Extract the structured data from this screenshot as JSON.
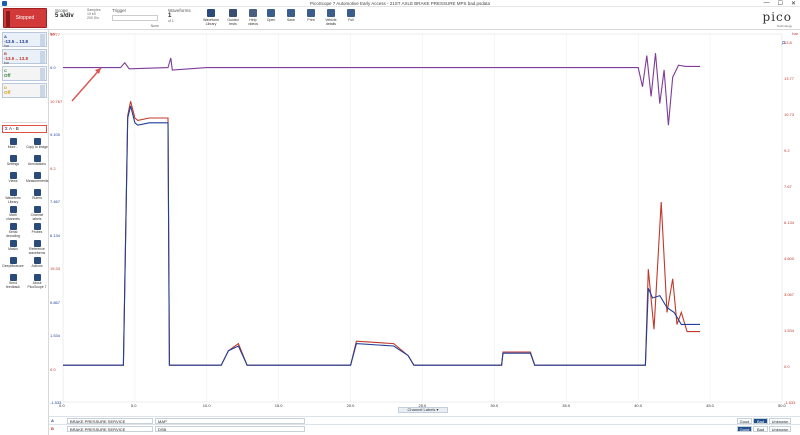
{
  "window": {
    "title": "PicoScope 7 Automotive Early Access - 21ST AXLE BRAKE PRESSURE MPS bad.psdata",
    "controls": [
      "—",
      "☐",
      "✕"
    ]
  },
  "ribbon": {
    "run_button": "Stopped",
    "scope_label": "Scope",
    "timebase": "5 s/div",
    "samples_label": "Samples",
    "samples_value": "10 kS",
    "sample_rate": "200 S/s",
    "trigger_label": "Trigger",
    "trigger_value": "None",
    "waveforms_label": "Waveforms",
    "waveforms_value": "1",
    "waveforms_of": "of 1",
    "tools": [
      "Waveform Library",
      "Guided tests",
      "Help videos",
      "Open",
      "Save",
      "Print",
      "Vehicle details",
      "Full"
    ],
    "brand": "pico",
    "brand_sub": "Technology"
  },
  "sidebar": {
    "channels": [
      {
        "tag": "A",
        "range": "-13.5 .. 13.8",
        "unit": "bar",
        "coupling": "DC 1x1"
      },
      {
        "tag": "B",
        "range": "-13.5 .. 13.8",
        "unit": "bar",
        "coupling": "DC 1x1"
      },
      {
        "tag": "C",
        "range": "Off",
        "coupling": "DC"
      },
      {
        "tag": "D",
        "range": "Off",
        "coupling": "DC"
      }
    ],
    "math": "A - B",
    "tools": [
      {
        "name": "More...",
        "icon": "grid-icon"
      },
      {
        "name": "Copy to image",
        "icon": "image-icon"
      },
      {
        "name": "Settings",
        "icon": "gear-icon"
      },
      {
        "name": "Annotations",
        "icon": "annotation-icon"
      },
      {
        "name": "Views",
        "icon": "views-icon"
      },
      {
        "name": "Measurements",
        "icon": "measure-icon"
      },
      {
        "name": "Waveform Library",
        "icon": "library-icon"
      },
      {
        "name": "Rulers",
        "icon": "ruler-icon"
      },
      {
        "name": "Math channels",
        "icon": "sigma-icon"
      },
      {
        "name": "Channel labels",
        "icon": "label-icon"
      },
      {
        "name": "Serial decoding",
        "icon": "serial-icon"
      },
      {
        "name": "Probes",
        "icon": "probe-icon"
      },
      {
        "name": "Masks",
        "icon": "mask-icon"
      },
      {
        "name": "Reference waveforms",
        "icon": "reference-icon"
      },
      {
        "name": "DeepMeasure",
        "icon": "deepmeasure-icon"
      },
      {
        "name": "Actions",
        "icon": "actions-icon"
      },
      {
        "name": "Send feedback",
        "icon": "feedback-icon"
      },
      {
        "name": "About PicoScope 7",
        "icon": "info-icon"
      }
    ]
  },
  "axes": {
    "left_ticks": [
      "10.77",
      "0.0",
      "10.767",
      "9.100",
      "9.2",
      "7.467",
      "6.134",
      "15.33",
      "0.867",
      "1.534",
      "0.0",
      "-1.533"
    ],
    "left_colors": [
      "#c0392b",
      "#1f3f9a",
      "#c0392b",
      "#1f3f9a",
      "#c0392b",
      "#1f3f9a",
      "#1f3f9a",
      "#c0392b",
      "#1f3f9a",
      "#1f3f9a",
      "#c0392b",
      "#1f3f9a"
    ],
    "right_ticks": [
      "13.8",
      "13.77",
      "10.73",
      "9.2",
      "7.67",
      "6.134",
      "4.600",
      "3.067",
      "1.534",
      "0.0",
      "-1.533"
    ],
    "left_unit": "bar",
    "right_unit": "bar",
    "x_ticks": [
      "0.0",
      "5.0",
      "10.0",
      "15.0",
      "20.0",
      "25.0",
      "30.0",
      "35.0",
      "40.0",
      "45.0",
      "50.0"
    ]
  },
  "chart_data": {
    "type": "line",
    "xlabel": "",
    "ylabel": "",
    "xlim": [
      0,
      50
    ],
    "ylim": [
      -1.533,
      13.8
    ],
    "series": [
      {
        "name": "A",
        "color": "#c0392b"
      },
      {
        "name": "B",
        "color": "#1f3f9a"
      },
      {
        "name": "A - B",
        "color": "#7d3c98"
      }
    ]
  },
  "channel_labels_button": "Channel Labels",
  "bottom": {
    "rows": [
      {
        "ch": "A",
        "probe": "BRAKE PRESSURE SERVICE",
        "name": "MAP",
        "color": "#1f3f9a",
        "good": "Good",
        "bad": "Bad",
        "unknown": "Unknown",
        "active": "bad"
      },
      {
        "ch": "B",
        "probe": "BRAKE PRESSURE SERVICE",
        "name": "DSB",
        "color": "#c0392b",
        "good": "Good",
        "bad": "Bad",
        "unknown": "Unknown",
        "active": "good"
      }
    ]
  }
}
